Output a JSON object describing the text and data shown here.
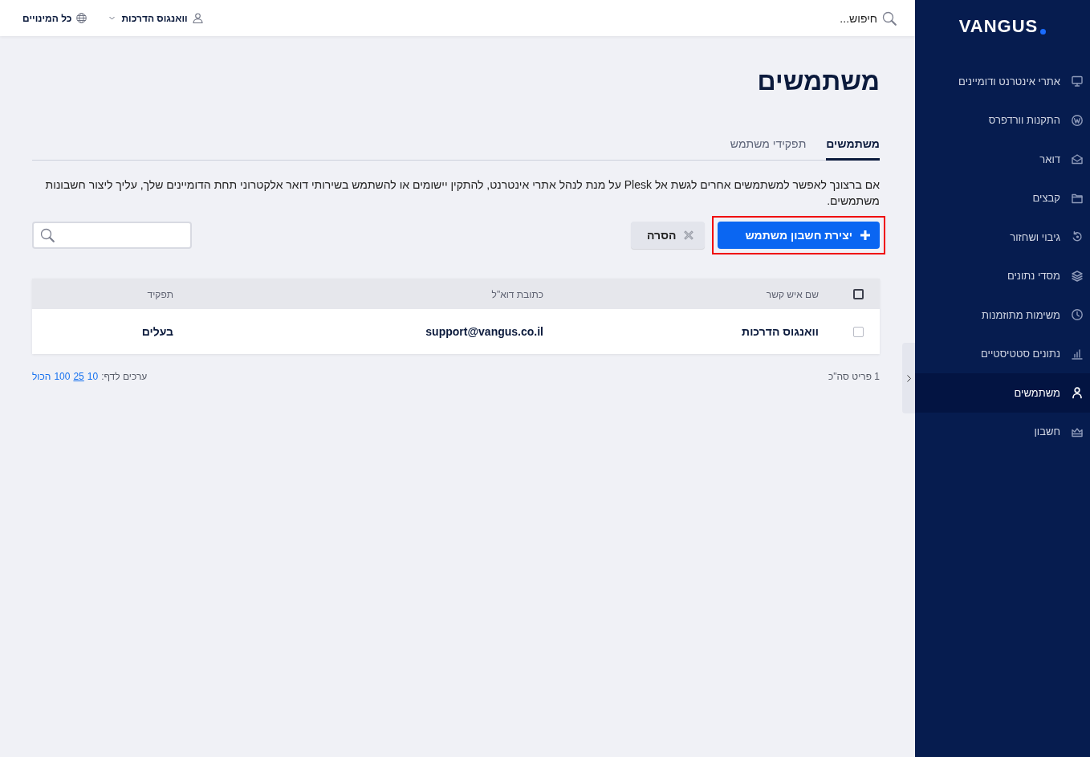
{
  "sidebar": {
    "logo": "VANGUS",
    "items": [
      {
        "label": "אתרי אינטרנט ודומיינים",
        "selected": false
      },
      {
        "label": "התקנות וורדפרס",
        "selected": false
      },
      {
        "label": "דואר",
        "selected": false
      },
      {
        "label": "קבצים",
        "selected": false
      },
      {
        "label": "גיבוי ושחזור",
        "selected": false
      },
      {
        "label": "מסדי נתונים",
        "selected": false
      },
      {
        "label": "משימות מתוזמנות",
        "selected": false
      },
      {
        "label": "נתונים סטטיסטיים",
        "selected": false
      },
      {
        "label": "משתמשים",
        "selected": true
      },
      {
        "label": "חשבון",
        "selected": false
      }
    ]
  },
  "topbar": {
    "search": {
      "placeholder": "חיפוש..."
    },
    "user_menu": {
      "label": "וואנגוס הדרכות"
    },
    "subscriptions": {
      "label": "כל המינויים"
    }
  },
  "page": {
    "title": "משתמשים",
    "tabs": [
      {
        "label": "משתמשים",
        "selected": true
      },
      {
        "label": "תפקידי משתמש",
        "selected": false
      }
    ],
    "description": "אם ברצונך לאפשר למשתמשים אחרים לגשת אל Plesk על מנת לנהל אתרי אינטרנט, להתקין יישומים או להשתמש בשירותי דואר אלקטרוני תחת הדומיינים שלך, עליך ליצור חשבונות משתמשים.",
    "buttons": [
      {
        "kind": "primary",
        "label": "יצירת חשבון משתמש",
        "highlighted": true
      },
      {
        "kind": "secondary",
        "label": "הסרה",
        "highlighted": false
      }
    ]
  },
  "table": {
    "select_all": {
      "checked": false
    },
    "columns": [
      "שם איש קשר",
      "כתובת דוא\"ל",
      "תפקיד"
    ],
    "rows": [
      {
        "checked": false,
        "cells": [
          "וואנגוס הדרכות",
          "support@vangus.co.il",
          "בעלים"
        ]
      }
    ]
  },
  "footer": {
    "total": "1 פריט סה\"כ",
    "per_page_label": "ערכים לדף:",
    "per_page_options": [
      {
        "label": "10",
        "underlined": false
      },
      {
        "label": "25",
        "underlined": true
      },
      {
        "label": "100",
        "underlined": false
      },
      {
        "label": "הכול",
        "underlined": false
      }
    ]
  }
}
